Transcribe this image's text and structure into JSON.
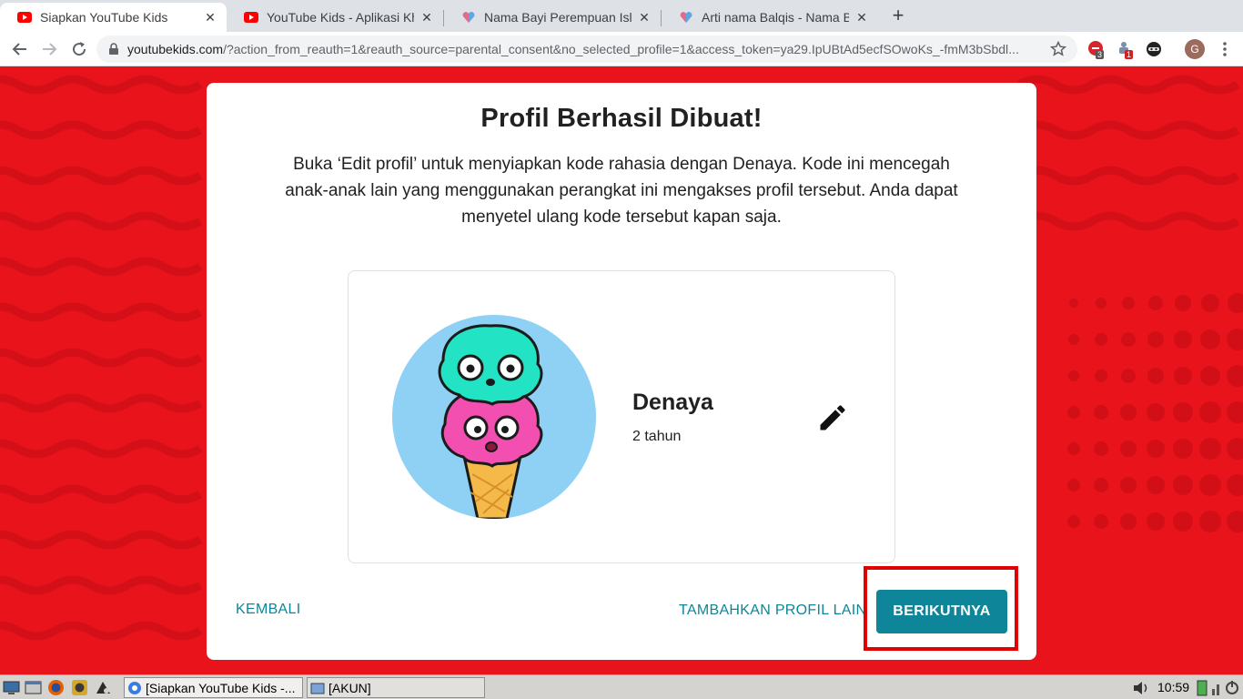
{
  "browser": {
    "tabs": [
      {
        "title": "Siapkan YouTube Kids",
        "favicon": "youtube-icon",
        "active": true
      },
      {
        "title": "YouTube Kids - Aplikasi Kh",
        "favicon": "youtube-icon",
        "active": false
      },
      {
        "title": "Nama Bayi Perempuan Isl",
        "favicon": "heart-icon",
        "active": false
      },
      {
        "title": "Arti nama Balqis - Nama B",
        "favicon": "heart-icon",
        "active": false
      }
    ],
    "close_glyph": "✕",
    "new_tab_glyph": "+",
    "url_host": "youtubekids.com",
    "url_path": "/?action_from_reauth=1&reauth_source=parental_consent&no_selected_profile=1&access_token=ya29.IpUBtAd5ecfSOwoKs_-fmM3bSbdl...",
    "extensions": [
      {
        "icon": "adblock-icon",
        "badge": "3"
      },
      {
        "icon": "puzzle-icon",
        "badge": "1"
      },
      {
        "icon": "ninja-icon",
        "badge": ""
      }
    ],
    "profile_initial": "G"
  },
  "page": {
    "title": "Profil Berhasil Dibuat!",
    "description": "Buka ‘Edit profil’ untuk menyiapkan kode rahasia dengan Denaya. Kode ini mencegah anak-anak lain yang menggunakan perangkat ini mengakses profil tersebut. Anda dapat menyetel ulang kode tersebut kapan saja.",
    "profile": {
      "name": "Denaya",
      "age": "2 tahun",
      "avatar": "ice-cream-avatar"
    },
    "back_label": "KEMBALI",
    "add_profile_label": "TAMBAHKAN PROFIL LAIN",
    "next_label": "BERIKUTNYA"
  },
  "taskbar": {
    "tasks": [
      {
        "label": "[Siapkan YouTube Kids -..."
      },
      {
        "label": "[AKUN]"
      }
    ],
    "clock": "10:59"
  },
  "colors": {
    "page_bg": "#e8131b",
    "accent": "#0e8598",
    "highlight": "#e10000"
  }
}
